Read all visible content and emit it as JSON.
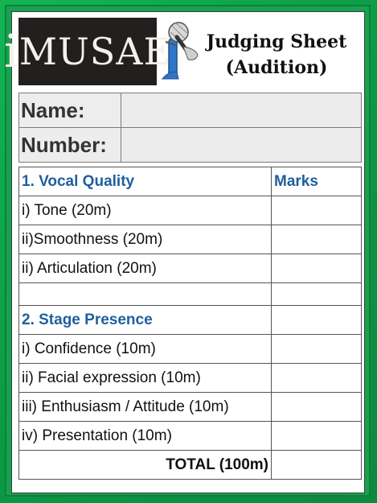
{
  "colors": {
    "frame": "#12b554",
    "heading": "#1f5f9e"
  },
  "logo": {
    "text_i": "i",
    "text_rest": "MUSAE"
  },
  "title": {
    "line1": "Judging Sheet",
    "line2": "(Audition)"
  },
  "info": {
    "name_label": "Name:",
    "number_label": "Number:"
  },
  "table": {
    "section1": "1. Vocal Quality",
    "marks_header": "Marks",
    "items1": [
      "i) Tone (20m)",
      "ii)Smoothness (20m)",
      "ii) Articulation (20m)"
    ],
    "section2": "2. Stage Presence",
    "items2": [
      "i) Confidence (10m)",
      "ii) Facial expression (10m)",
      "iii) Enthusiasm / Attitude (10m)",
      "iv) Presentation (10m)"
    ],
    "total": "TOTAL (100m)"
  }
}
